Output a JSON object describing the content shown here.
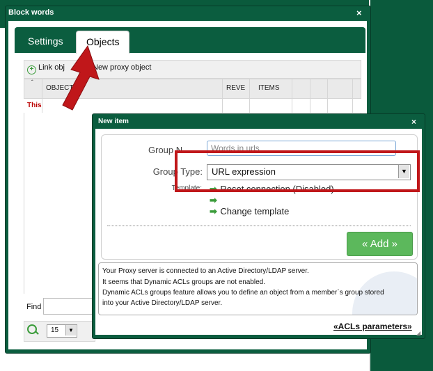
{
  "main_dialog": {
    "title": "Block words",
    "close": "×",
    "tabs": [
      {
        "label": "Settings"
      },
      {
        "label": "Objects"
      }
    ],
    "toolbar": {
      "link_object": "Link obj",
      "new_proxy_object": "New proxy object"
    },
    "grid": {
      "columns": [
        "OBJECTS",
        "REVE",
        "ITEMS"
      ],
      "rows": [
        {
          "first_cell": "This"
        }
      ]
    },
    "find_label": "Find",
    "pager": {
      "page_size": "15"
    }
  },
  "new_item_dialog": {
    "title": "New item",
    "close": "×",
    "group_name_label": "Group N",
    "group_name_value": "Words in urls",
    "group_type_label": "Group Type:",
    "group_type_value": "URL expression",
    "template_label": "Template:",
    "template_options": [
      {
        "label": "Reset connection (Disabled)"
      },
      {
        "label": ""
      },
      {
        "label": "Change template"
      }
    ],
    "add_button": "« Add »",
    "info_lines": [
      "Your Proxy server is connected to an Active Directory/LDAP server.",
      "It seems that Dynamic ACLs groups are not enabled.",
      "Dynamic ACLs groups feature allows you to define an object from a member`s group stored",
      "into your Active Directory/LDAP server."
    ],
    "acl_link": "«ACLs parameters»"
  },
  "colors": {
    "title_bar": "#0b5d3f",
    "add_button": "#5cb85c",
    "highlight": "#c0171a",
    "error_text": "#bb0000"
  },
  "icons": [
    "plus-circle-icon",
    "close-icon",
    "dropdown-arrow-icon",
    "arrow-right-icon",
    "search-icon",
    "red-arrow-pointer-icon"
  ]
}
